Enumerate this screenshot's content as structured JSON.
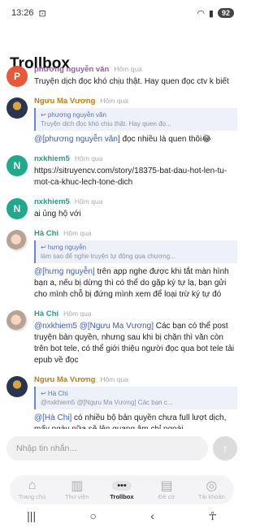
{
  "status_bar": {
    "time": "13:26",
    "battery": "92"
  },
  "page_title": "Trollbox",
  "messages": [
    {
      "avatar_letter": "P",
      "name": "phương nguyễn văn",
      "time": "Hôm qua",
      "text": "Truyện dịch đọc khó chịu thật. Hay quen đọc ctv k biết"
    },
    {
      "name": "Ngưu Ma Vương",
      "time": "Hôm qua",
      "quote_name": "↩ phương nguyễn văn",
      "quote_text": "Truyện dịch đọc khó chịu thật. Hay quen đọ...",
      "mention": "@[phương nguyễn văn]",
      "text": " đọc nhiều là quen thôi😂"
    },
    {
      "avatar_letter": "N",
      "name": "nxkhiem5",
      "time": "Hôm qua",
      "text": "https://sitruyencv.com/story/18375-bat-dau-hot-len-tu-mot-ca-khuc-lech-tone-dich"
    },
    {
      "avatar_letter": "N",
      "name": "nxkhiem5",
      "time": "Hôm qua",
      "text": "ai ủng hộ với"
    },
    {
      "name": "Hà Chi",
      "time": "Hôm qua",
      "quote_name": "↩ hưng nguyễn",
      "quote_text": "làm sao để nghe truyện tự động qua chương...",
      "mention": "@[hưng nguyễn]",
      "text": " trên app nghe được khi tắt màn hình bạn a, nếu bị dừng thì có thể do gặp ký tự lạ, bạn gửi cho mình chỗ bị đứng mình xem để loại trừ ký tự đó"
    },
    {
      "name": "Hà Chi",
      "time": "Hôm qua",
      "mention": "@nxkhiem5 @[Ngưu Ma Vương]",
      "text": " Các bạn có thể post truyện bản quyền, nhưng sau khi bị chặn thì văn còn trên bot tele, có thể giới thiệu người đọc qua bot tele tải epub về đọc"
    },
    {
      "name": "Ngưu Ma Vương",
      "time": "Hôm qua",
      "quote_name": "↩ Hà Chi",
      "quote_text": "@nxkhiem5 @[Ngưu Ma Vương] Các bạn c...",
      "mention": "@[Hà Chi]",
      "text": " có nhiều bộ bản quyền chưa full lượt dịch, mấy ngày nữa sẽ lên quang âm chỉ ngoài"
    }
  ],
  "input": {
    "placeholder": "Nhập tin nhắn..."
  },
  "tabs": [
    {
      "label": "Trang chủ",
      "icon": "⌂"
    },
    {
      "label": "Thư viện",
      "icon": "▥"
    },
    {
      "label": "Trollbox",
      "icon": "•••"
    },
    {
      "label": "Đề cử",
      "icon": "▤"
    },
    {
      "label": "Tài khoản",
      "icon": "◎"
    }
  ],
  "colors": {
    "accent": "#3a5bbf",
    "purple_name": "#9a5bb3",
    "orange_name": "#c27e10",
    "teal_name": "#2a9b8a"
  }
}
